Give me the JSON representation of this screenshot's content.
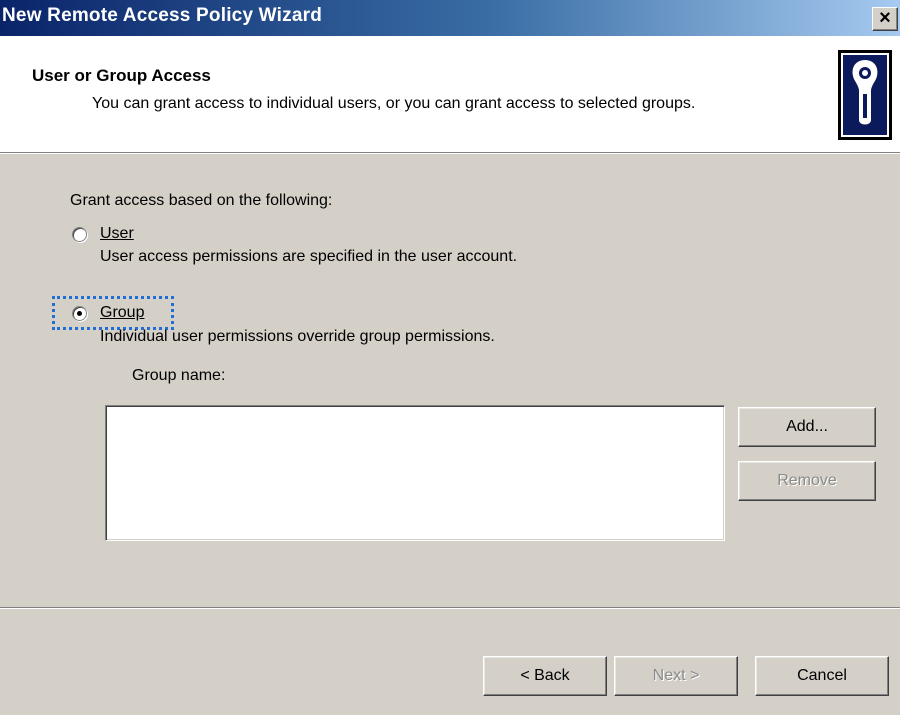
{
  "window": {
    "title": "New Remote Access Policy Wizard",
    "close_glyph": "×"
  },
  "header": {
    "title": "User or Group Access",
    "description": "You can grant access to individual users, or you can grant access to selected groups.",
    "icon": "security-key-icon"
  },
  "content": {
    "grant_label": "Grant access based on the following:",
    "options": [
      {
        "label": "User",
        "description": "User access permissions are specified in the user account.",
        "selected": false
      },
      {
        "label": "Group",
        "description": "Individual user permissions override group permissions.",
        "selected": true
      }
    ],
    "group_name_label": "Group name:",
    "group_list": [],
    "add_label": "Add...",
    "remove_label": "Remove"
  },
  "footer": {
    "back_label": "< Back",
    "next_label": "Next >",
    "cancel_label": "Cancel"
  }
}
